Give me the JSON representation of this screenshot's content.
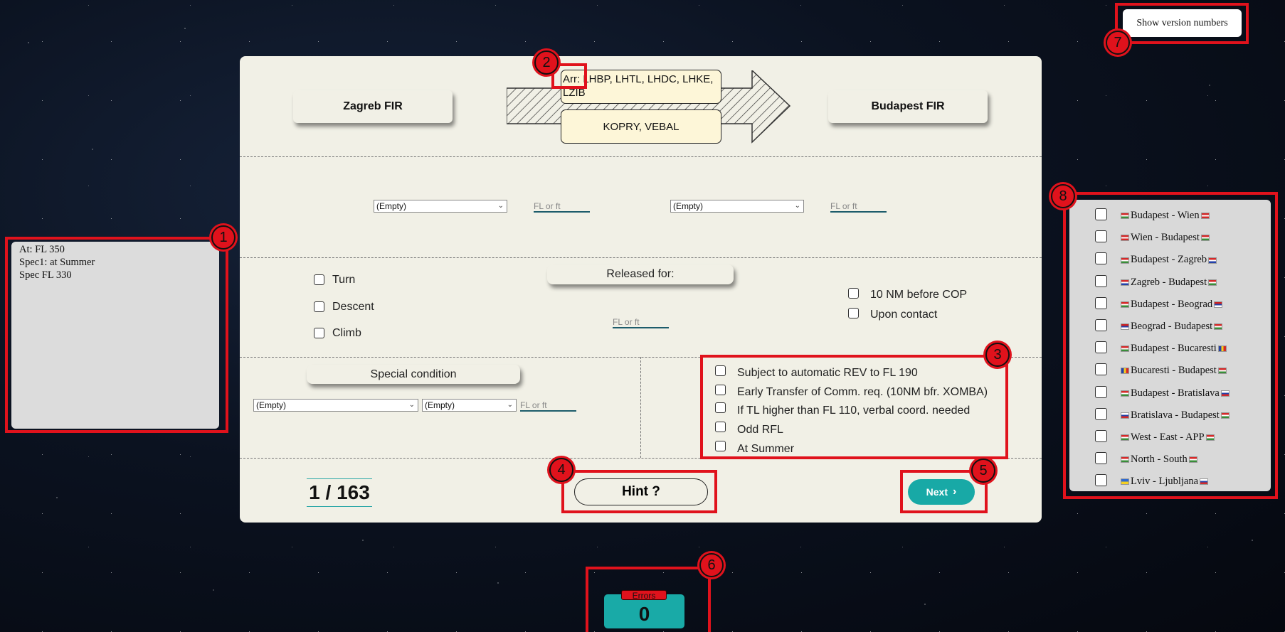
{
  "left_note": {
    "lines": [
      "At: FL 350",
      "Spec1: at Summer",
      "Spec FL 330"
    ]
  },
  "header": {
    "left_fir": "Zagreb FIR",
    "right_fir": "Budapest FIR",
    "arrival_box": "Arr: LHBP, LHTL, LHDC, LHKE, LZIB",
    "points_box": "KOPRY, VEBAL"
  },
  "levels_row": {
    "select1": "(Empty)",
    "input1_placeholder": "FL or ft",
    "select2": "(Empty)",
    "input2_placeholder": "FL or ft"
  },
  "release": {
    "options": [
      "Turn",
      "Descent",
      "Climb"
    ],
    "title": "Released for:",
    "input_placeholder": "FL or ft",
    "timing": [
      "10 NM before COP",
      "Upon contact"
    ]
  },
  "special": {
    "title": "Special condition",
    "select1": "(Empty)",
    "select2": "(Empty)",
    "input_placeholder": "FL or ft",
    "conditions": [
      "Subject to automatic REV to FL 190",
      "Early Transfer of Comm. req. (10NM bfr. XOMBA)",
      "If TL higher than FL 110, verbal coord. needed",
      "Odd RFL",
      "At Summer"
    ]
  },
  "footer": {
    "counter": "1 / 163",
    "hint": "Hint  ?",
    "next": "Next"
  },
  "version_button": "Show version numbers",
  "sectors": [
    {
      "label": "Budapest - Wien",
      "f1": "hu",
      "f2": "at"
    },
    {
      "label": "Wien - Budapest",
      "f1": "at",
      "f2": "hu"
    },
    {
      "label": "Budapest - Zagreb",
      "f1": "hu",
      "f2": "hr"
    },
    {
      "label": "Zagreb - Budapest",
      "f1": "hr",
      "f2": "hu"
    },
    {
      "label": "Budapest - Beograd",
      "f1": "hu",
      "f2": "rs"
    },
    {
      "label": "Beograd - Budapest",
      "f1": "rs",
      "f2": "hu"
    },
    {
      "label": "Budapest - Bucaresti",
      "f1": "hu",
      "f2": "ro"
    },
    {
      "label": "Bucaresti - Budapest",
      "f1": "ro",
      "f2": "hu"
    },
    {
      "label": "Budapest - Bratislava",
      "f1": "hu",
      "f2": "sk"
    },
    {
      "label": "Bratislava - Budapest",
      "f1": "sk",
      "f2": "hu"
    },
    {
      "label": "West - East - APP",
      "f1": "hu",
      "f2": "hu"
    },
    {
      "label": "North - South",
      "f1": "hu",
      "f2": "hu"
    },
    {
      "label": "Lviv - Ljubljana",
      "f1": "ua",
      "f2": "si"
    }
  ],
  "errors": {
    "label": "Errors",
    "count": "0"
  },
  "annotations": [
    "1",
    "2",
    "3",
    "4",
    "5",
    "6",
    "7",
    "8"
  ],
  "colors": {
    "accent": "#18a9a6",
    "annotation": "#e0121c",
    "panel": "#f1f0e6"
  }
}
